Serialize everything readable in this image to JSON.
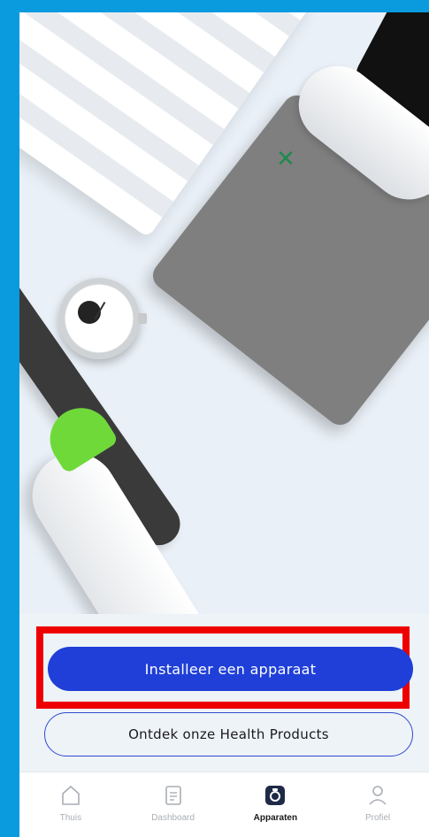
{
  "main": {
    "install_button": "Installeer een apparaat",
    "discover_button": "Ontdek onze Health Products"
  },
  "tabs": [
    {
      "label": "Thuis",
      "icon": "home-icon",
      "active": false
    },
    {
      "label": "Dashboard",
      "icon": "dashboard-icon",
      "active": false
    },
    {
      "label": "Apparaten",
      "icon": "devices-icon",
      "active": true
    },
    {
      "label": "Profiel",
      "icon": "profile-icon",
      "active": false
    }
  ],
  "colors": {
    "frame": "#0a9ade",
    "primary": "#1f3fd8",
    "highlight": "#ef0000",
    "thermo_cap": "#6fd93a"
  }
}
